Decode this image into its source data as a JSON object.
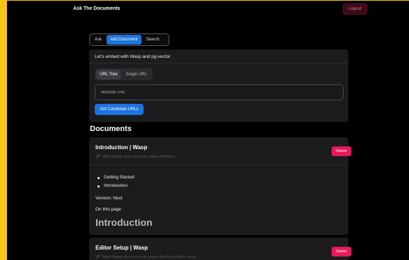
{
  "app": {
    "title": "Ask The Documents",
    "logout_label": "Logout"
  },
  "tabs": [
    {
      "label": "Ask"
    },
    {
      "label": "Add Document"
    },
    {
      "label": "Search"
    }
  ],
  "embed": {
    "heading": "Let's embed with Wasp and pg-vector",
    "subtabs": [
      {
        "label": "URL Tree"
      },
      {
        "label": "Single URL"
      }
    ],
    "url_placeholder": "Website URL",
    "url_value": "",
    "button_label": "Get Candidate URLs"
  },
  "documents": {
    "heading": "Documents",
    "items": [
      {
        "title": "Introduction | Wasp",
        "url": "https://wasp-docs-on-main.pages.dev/docs",
        "delete_label": "Delete",
        "list": [
          "Getting Started",
          "Introduction"
        ],
        "version": "Version: Next",
        "on_page": "On this page",
        "h1": "Introduction"
      },
      {
        "title": "Editor Setup | Wasp",
        "url": "https://wasp-docs-on-main.pages.dev/docs/editor-setup",
        "delete_label": "Delete"
      }
    ]
  },
  "colors": {
    "accent": "#1c74e0",
    "danger": "#e8195a",
    "frame": "#f5c518",
    "card": "#1c1c1e"
  }
}
